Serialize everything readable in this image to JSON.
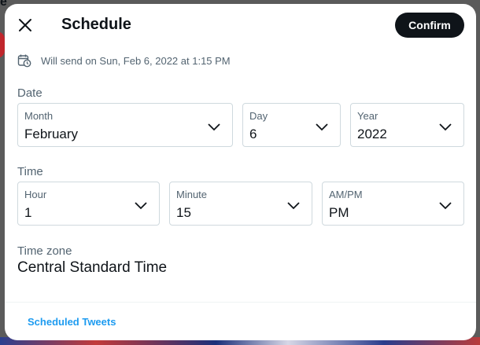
{
  "background": {
    "partial_top_text": "e"
  },
  "modal": {
    "title": "Schedule",
    "confirm_label": "Confirm",
    "close_icon": "close-icon",
    "send_note": "Will send on Sun, Feb 6, 2022 at 1:15 PM",
    "date_section": {
      "label": "Date",
      "month": {
        "label": "Month",
        "value": "February"
      },
      "day": {
        "label": "Day",
        "value": "6"
      },
      "year": {
        "label": "Year",
        "value": "2022"
      }
    },
    "time_section": {
      "label": "Time",
      "hour": {
        "label": "Hour",
        "value": "1"
      },
      "minute": {
        "label": "Minute",
        "value": "15"
      },
      "ampm": {
        "label": "AM/PM",
        "value": "PM"
      }
    },
    "timezone": {
      "label": "Time zone",
      "value": "Central Standard Time"
    },
    "footer_link": "Scheduled Tweets"
  },
  "colors": {
    "accent": "#1d9bf0",
    "primary_text": "#0f1419",
    "secondary_text": "#536471",
    "border": "#cfd9de",
    "confirm_bg": "#0f1419"
  }
}
